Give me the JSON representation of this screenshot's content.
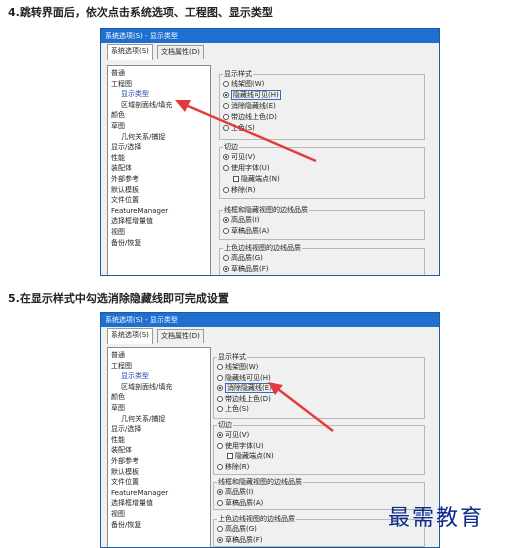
{
  "step4": {
    "title": "4.跳转界面后，依次点击系统选项、工程图、显示类型",
    "window_title": "系统选项(S) - 显示类型",
    "tabs": [
      "系统选项(S)",
      "文档属性(D)"
    ],
    "tree": [
      {
        "label": "普通",
        "level": 0
      },
      {
        "label": "工程图",
        "level": 0
      },
      {
        "label": "显示类型",
        "level": 1,
        "selected": true
      },
      {
        "label": "区域剖面线/填充",
        "level": 1
      },
      {
        "label": "颜色",
        "level": 0
      },
      {
        "label": "草图",
        "level": 0
      },
      {
        "label": "几何关系/捕捉",
        "level": 1
      },
      {
        "label": "显示/选择",
        "level": 0
      },
      {
        "label": "性能",
        "level": 0
      },
      {
        "label": "装配体",
        "level": 0
      },
      {
        "label": "外部参考",
        "level": 0
      },
      {
        "label": "默认模板",
        "level": 0
      },
      {
        "label": "文件位置",
        "level": 0
      },
      {
        "label": "FeatureManager",
        "level": 0
      },
      {
        "label": "选择框增量值",
        "level": 0
      },
      {
        "label": "视图",
        "level": 0
      },
      {
        "label": "备份/恢复",
        "level": 0
      }
    ],
    "display_style": {
      "label": "显示样式",
      "options": [
        {
          "label": "线架图(W)",
          "checked": false
        },
        {
          "label": "隐藏线可见(H)",
          "checked": true
        },
        {
          "label": "消除隐藏线(E)",
          "checked": false
        },
        {
          "label": "带边线上色(D)",
          "checked": false
        },
        {
          "label": "上色(S)",
          "checked": false
        }
      ]
    },
    "tangent": {
      "label": "切边",
      "options": [
        {
          "label": "可见(V)",
          "checked": true
        },
        {
          "label": "使用字体(U)",
          "checked": false
        },
        {
          "label": "隐藏端点(N)",
          "checked": false,
          "checkbox": true
        },
        {
          "label": "移除(R)",
          "checked": false
        }
      ]
    },
    "edge_quality_hidden": {
      "label": "线框和隐藏视图的边线品质",
      "options": [
        {
          "label": "高品质(I)",
          "checked": true
        },
        {
          "label": "草稿品质(A)",
          "checked": false
        }
      ]
    },
    "edge_quality_shaded": {
      "label": "上色边线视图的边线品质",
      "options": [
        {
          "label": "高品质(G)",
          "checked": false
        },
        {
          "label": "草稿品质(F)",
          "checked": true
        }
      ]
    }
  },
  "step5": {
    "title": "5.在显示样式中勾选消除隐藏线即可完成设置",
    "window_title": "系统选项(S) - 显示类型",
    "tabs": [
      "系统选项(S)",
      "文档属性(D)"
    ],
    "tree": [
      {
        "label": "普通",
        "level": 0
      },
      {
        "label": "工程图",
        "level": 0
      },
      {
        "label": "显示类型",
        "level": 1,
        "selected": true
      },
      {
        "label": "区域剖面线/填充",
        "level": 1
      },
      {
        "label": "颜色",
        "level": 0
      },
      {
        "label": "草图",
        "level": 0
      },
      {
        "label": "几何关系/捕捉",
        "level": 1
      },
      {
        "label": "显示/选择",
        "level": 0
      },
      {
        "label": "性能",
        "level": 0
      },
      {
        "label": "装配体",
        "level": 0
      },
      {
        "label": "外部参考",
        "level": 0
      },
      {
        "label": "默认模板",
        "level": 0
      },
      {
        "label": "文件位置",
        "level": 0
      },
      {
        "label": "FeatureManager",
        "level": 0
      },
      {
        "label": "选择框增量值",
        "level": 0
      },
      {
        "label": "视图",
        "level": 0
      },
      {
        "label": "备份/恢复",
        "level": 0
      }
    ],
    "display_style": {
      "label": "显示样式",
      "options": [
        {
          "label": "线架图(W)",
          "checked": false
        },
        {
          "label": "隐藏线可见(H)",
          "checked": false
        },
        {
          "label": "消除隐藏线(E)",
          "checked": true
        },
        {
          "label": "带边线上色(D)",
          "checked": false
        },
        {
          "label": "上色(S)",
          "checked": false
        }
      ]
    },
    "tangent": {
      "label": "切边",
      "options": [
        {
          "label": "可见(V)",
          "checked": true
        },
        {
          "label": "使用字体(U)",
          "checked": false
        },
        {
          "label": "隐藏端点(N)",
          "checked": false,
          "checkbox": true
        },
        {
          "label": "移除(R)",
          "checked": false
        }
      ]
    },
    "edge_quality_hidden": {
      "label": "线框和隐藏视图的边线品质",
      "options": [
        {
          "label": "高品质(I)",
          "checked": true
        },
        {
          "label": "草稿品质(A)",
          "checked": false
        }
      ]
    },
    "edge_quality_shaded": {
      "label": "上色边线视图的边线品质",
      "options": [
        {
          "label": "高品质(G)",
          "checked": false
        },
        {
          "label": "草稿品质(F)",
          "checked": true
        }
      ]
    }
  },
  "watermark": "最需教育",
  "colors": {
    "titlebar": "#1f6fd1",
    "arrow": "#e23b3b",
    "selection": "#1a3fb8",
    "watermark": "#0d2a8c"
  }
}
